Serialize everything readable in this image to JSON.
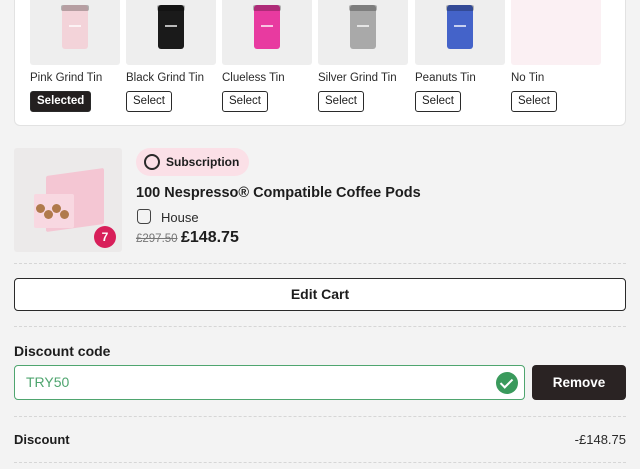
{
  "tins": [
    {
      "name": "Pink Grind Tin",
      "button": "Selected",
      "selected": true,
      "color": "#f3d3d9",
      "label_color": "#c0a0a8"
    },
    {
      "name": "Black Grind Tin",
      "button": "Select",
      "selected": false,
      "color": "#1a1a1a",
      "label_color": "#dddddd"
    },
    {
      "name": "Clueless Tin",
      "button": "Select",
      "selected": false,
      "color": "#e83aa0",
      "label_color": "#ffd6ec"
    },
    {
      "name": "Silver Grind Tin",
      "button": "Select",
      "selected": false,
      "color": "#a9a9a9",
      "label_color": "#ededed"
    },
    {
      "name": "Peanuts Tin",
      "button": "Select",
      "selected": false,
      "color": "#4463c9",
      "label_color": "#f0593a"
    },
    {
      "name": "No Tin",
      "button": "Select",
      "selected": false,
      "color": "",
      "label_color": ""
    }
  ],
  "cart_item": {
    "subscription_label": "Subscription",
    "title": "100 Nespresso® Compatible Coffee Pods",
    "variant": "House",
    "old_price": "£297.50",
    "price": "£148.75",
    "quantity": "7"
  },
  "edit_cart_label": "Edit Cart",
  "discount": {
    "label": "Discount code",
    "code": "TRY50",
    "remove_label": "Remove",
    "row_label": "Discount",
    "row_value": "-£148.75"
  },
  "colors": {
    "accent_pink": "#d81f5a",
    "success_green": "#3a9a5c",
    "dark": "#2a2323"
  }
}
